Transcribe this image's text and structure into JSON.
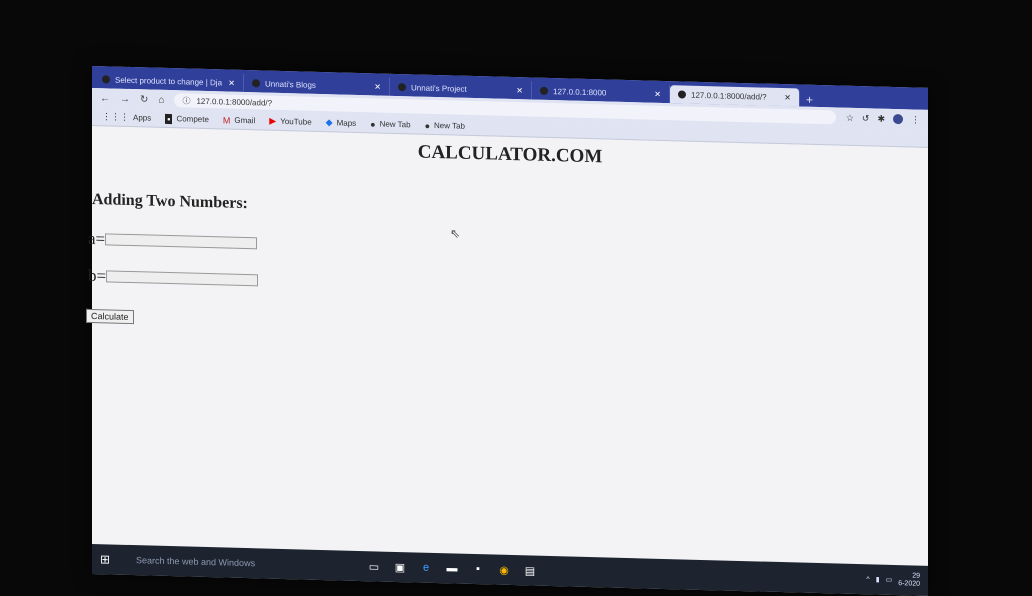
{
  "browser": {
    "tabs": [
      {
        "title": "Select product to change | Dja",
        "active": false
      },
      {
        "title": "Unnati's Blogs",
        "active": false
      },
      {
        "title": "Unnati's Project",
        "active": false
      },
      {
        "title": "127.0.0.1:8000",
        "active": false
      },
      {
        "title": "127.0.0.1:8000/add/?",
        "active": true
      }
    ],
    "new_tab_label": "+",
    "address": "127.0.0.1:8000/add/?",
    "bookmarks": [
      {
        "label": "Apps",
        "icon": "apps-grid-icon"
      },
      {
        "label": "Compete",
        "icon": "compete-icon"
      },
      {
        "label": "Gmail",
        "icon": "gmail-icon"
      },
      {
        "label": "YouTube",
        "icon": "youtube-icon"
      },
      {
        "label": "Maps",
        "icon": "maps-icon"
      },
      {
        "label": "New Tab",
        "icon": "globe-icon"
      },
      {
        "label": "New Tab",
        "icon": "globe-icon"
      }
    ]
  },
  "page": {
    "title": "CALCULATOR.COM",
    "heading": "Adding Two Numbers:",
    "field_a_label": "a=",
    "field_a_value": "",
    "field_b_label": "b=",
    "field_b_value": "",
    "button_label": "Calculate"
  },
  "taskbar": {
    "search_placeholder": "Search the web and Windows",
    "clock_time": "29",
    "clock_date": "6-2020"
  }
}
